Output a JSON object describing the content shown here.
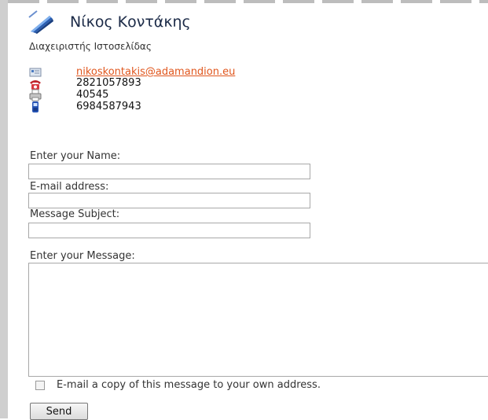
{
  "contact": {
    "name": "Νίκος Κοντάκης",
    "role": "Διαχειριστής Ιστοσελίδας",
    "email": "nikoskontakis@adamandion.eu",
    "telephone": "2821057893",
    "fax": "40545",
    "mobile": "6984587943",
    "icons": [
      "contact-card-icon",
      "email-icon",
      "telephone-icon",
      "fax-icon",
      "mobile-icon"
    ]
  },
  "form": {
    "name_label": "Enter your Name:",
    "email_label": "E-mail address:",
    "subject_label": "Message Subject:",
    "message_label": "Enter your Message:",
    "name_value": "",
    "email_value": "",
    "subject_value": "",
    "message_value": "",
    "copy_label": "E-mail a copy of this message to your own address.",
    "copy_checked": false,
    "send_label": "Send"
  },
  "colors": {
    "link": "#e0561d",
    "name": "#1b2a47"
  }
}
